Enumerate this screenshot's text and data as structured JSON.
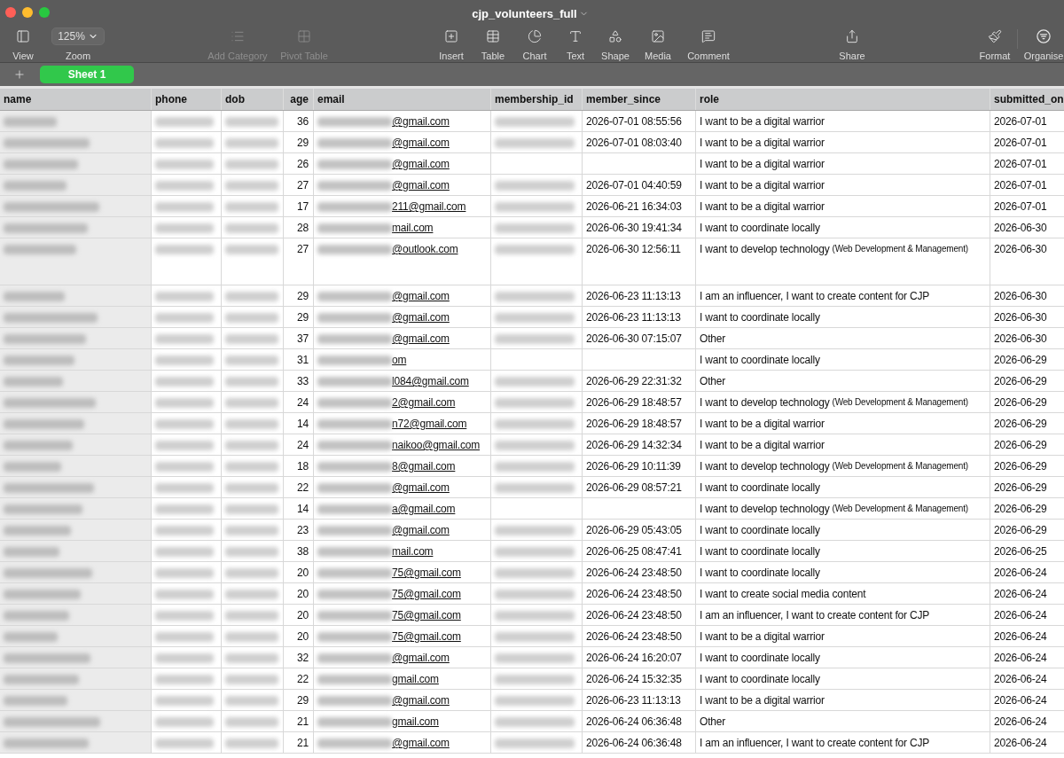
{
  "window": {
    "title": "cjp_volunteers_full"
  },
  "toolbar": [
    {
      "kind": "button",
      "label": "View",
      "disabled": false
    },
    {
      "kind": "dropdown",
      "label": "Zoom",
      "value": "125%",
      "disabled": false
    },
    {
      "kind": "button",
      "label": "Add Category",
      "disabled": true
    },
    {
      "kind": "button",
      "label": "Pivot Table",
      "disabled": true
    },
    {
      "kind": "button",
      "label": "Insert",
      "disabled": false
    },
    {
      "kind": "button",
      "label": "Table",
      "disabled": false
    },
    {
      "kind": "button",
      "label": "Chart",
      "disabled": false
    },
    {
      "kind": "button",
      "label": "Text",
      "disabled": false
    },
    {
      "kind": "button",
      "label": "Shape",
      "disabled": false
    },
    {
      "kind": "button",
      "label": "Media",
      "disabled": false
    },
    {
      "kind": "button",
      "label": "Comment",
      "disabled": false
    },
    {
      "kind": "button",
      "label": "Share",
      "disabled": false
    },
    {
      "kind": "button",
      "label": "Format",
      "disabled": false
    },
    {
      "kind": "button",
      "label": "Organise",
      "disabled": false
    }
  ],
  "sheet_tabs": [
    {
      "label": "Sheet 1",
      "selected": true
    }
  ],
  "table": {
    "columns": [
      {
        "label": "name",
        "blurred": true
      },
      {
        "label": "phone",
        "blurred": true
      },
      {
        "label": "dob",
        "blurred": true
      },
      {
        "label": "age"
      },
      {
        "label": "email",
        "blurred": true
      },
      {
        "label": "membership_id",
        "blurred": true
      },
      {
        "label": "member_since"
      },
      {
        "label": "role"
      },
      {
        "label": "submitted_on"
      }
    ],
    "rows": [
      {
        "age": "36",
        "email": "@gmail.com",
        "membership_id_blurred": true,
        "member_since": "2026-07-01 08:55:56",
        "role": "I want to be a digital warrior",
        "submitted_on": "2026-07-01"
      },
      {
        "age": "29",
        "email": "@gmail.com",
        "membership_id_blurred": true,
        "member_since": "2026-07-01 08:03:40",
        "role": "I want to be a digital warrior",
        "submitted_on": "2026-07-01"
      },
      {
        "age": "26",
        "email": "@gmail.com",
        "membership_id_blurred": false,
        "role": "I want to be a digital warrior",
        "submitted_on": "2026-07-01"
      },
      {
        "age": "27",
        "email": "@gmail.com",
        "membership_id_blurred": true,
        "member_since": "2026-07-01 04:40:59",
        "role": "I want to be a digital warrior",
        "submitted_on": "2026-07-01"
      },
      {
        "age": "17",
        "email": "211@gmail.com",
        "membership_id_blurred": true,
        "member_since": "2026-06-21 16:34:03",
        "role": "I want to be a digital warrior",
        "submitted_on": "2026-07-01"
      },
      {
        "age": "28",
        "email": "mail.com",
        "membership_id_blurred": true,
        "member_since": "2026-06-30 19:41:34",
        "role": "I want to coordinate locally",
        "submitted_on": "2026-06-30"
      },
      {
        "age": "27",
        "email": "@outlook.com",
        "membership_id_blurred": true,
        "member_since": "2026-06-30 12:56:11",
        "role": "I want to develop technology",
        "role_note": "(Web Development & Management)",
        "submitted_on": "2026-06-30",
        "tall": true
      },
      {
        "age": "29",
        "email": "@gmail.com",
        "membership_id_blurred": true,
        "member_since": "2026-06-23 11:13:13",
        "role": "I am an influencer, I want to create content for CJP",
        "submitted_on": "2026-06-30"
      },
      {
        "age": "29",
        "email": "@gmail.com",
        "membership_id_blurred": true,
        "member_since": "2026-06-23 11:13:13",
        "role": "I want to coordinate locally",
        "submitted_on": "2026-06-30"
      },
      {
        "age": "37",
        "email": "@gmail.com",
        "membership_id_blurred": true,
        "member_since": "2026-06-30 07:15:07",
        "role": "Other",
        "submitted_on": "2026-06-30"
      },
      {
        "age": "31",
        "email": "om",
        "membership_id_blurred": false,
        "role": "I want to coordinate locally",
        "submitted_on": "2026-06-29"
      },
      {
        "age": "33",
        "email": "l084@gmail.com",
        "membership_id_blurred": true,
        "member_since": "2026-06-29 22:31:32",
        "role": "Other",
        "submitted_on": "2026-06-29"
      },
      {
        "age": "24",
        "email": "2@gmail.com",
        "membership_id_blurred": true,
        "member_since": "2026-06-29 18:48:57",
        "role": "I want to develop technology",
        "role_note": "(Web Development & Management)",
        "submitted_on": "2026-06-29"
      },
      {
        "age": "14",
        "email": "n72@gmail.com",
        "membership_id_blurred": true,
        "member_since": "2026-06-29 18:48:57",
        "role": "I want to be a digital warrior",
        "submitted_on": "2026-06-29"
      },
      {
        "age": "24",
        "email": "naikoo@gmail.com",
        "membership_id_blurred": true,
        "member_since": "2026-06-29 14:32:34",
        "role": "I want to be a digital warrior",
        "submitted_on": "2026-06-29"
      },
      {
        "age": "18",
        "email": "8@gmail.com",
        "membership_id_blurred": true,
        "member_since": "2026-06-29 10:11:39",
        "role": "I want to develop technology",
        "role_note": "(Web Development & Management)",
        "submitted_on": "2026-06-29"
      },
      {
        "age": "22",
        "email": "@gmail.com",
        "membership_id_blurred": true,
        "member_since": "2026-06-29 08:57:21",
        "role": "I want to coordinate locally",
        "submitted_on": "2026-06-29"
      },
      {
        "age": "14",
        "email": "a@gmail.com",
        "membership_id_blurred": false,
        "role": "I want to develop technology",
        "role_note": "(Web Development & Management)",
        "submitted_on": "2026-06-29"
      },
      {
        "age": "23",
        "email": "@gmail.com",
        "membership_id_blurred": true,
        "member_since": "2026-06-29 05:43:05",
        "role": "I want to coordinate locally",
        "submitted_on": "2026-06-29"
      },
      {
        "age": "38",
        "email": "mail.com",
        "membership_id_blurred": true,
        "member_since": "2026-06-25 08:47:41",
        "role": "I want to coordinate locally",
        "submitted_on": "2026-06-25"
      },
      {
        "age": "20",
        "email": "75@gmail.com",
        "membership_id_blurred": true,
        "member_since": "2026-06-24 23:48:50",
        "role": "I want to coordinate locally",
        "submitted_on": "2026-06-24"
      },
      {
        "age": "20",
        "email": "75@gmail.com",
        "membership_id_blurred": true,
        "member_since": "2026-06-24 23:48:50",
        "role": "I want to create social media content",
        "submitted_on": "2026-06-24"
      },
      {
        "age": "20",
        "email": "75@gmail.com",
        "membership_id_blurred": true,
        "member_since": "2026-06-24 23:48:50",
        "role": "I am an influencer, I want to create content for CJP",
        "submitted_on": "2026-06-24"
      },
      {
        "age": "20",
        "email": "75@gmail.com",
        "membership_id_blurred": true,
        "member_since": "2026-06-24 23:48:50",
        "role": "I want to be a digital warrior",
        "submitted_on": "2026-06-24"
      },
      {
        "age": "32",
        "email": "@gmail.com",
        "membership_id_blurred": true,
        "member_since": "2026-06-24 16:20:07",
        "role": "I want to coordinate locally",
        "submitted_on": "2026-06-24"
      },
      {
        "age": "22",
        "email": "gmail.com",
        "membership_id_blurred": true,
        "member_since": "2026-06-24 15:32:35",
        "role": "I want to coordinate locally",
        "submitted_on": "2026-06-24"
      },
      {
        "age": "29",
        "email": "@gmail.com",
        "membership_id_blurred": true,
        "member_since": "2026-06-23 11:13:13",
        "role": "I want to be a digital warrior",
        "submitted_on": "2026-06-24"
      },
      {
        "age": "21",
        "email": "gmail.com",
        "membership_id_blurred": true,
        "member_since": "2026-06-24 06:36:48",
        "role": "Other",
        "submitted_on": "2026-06-24"
      },
      {
        "age": "21",
        "email": "@gmail.com",
        "membership_id_blurred": true,
        "member_since": "2026-06-24 06:36:48",
        "role": "I am an influencer, I want to create content for CJP",
        "submitted_on": "2026-06-24"
      }
    ]
  }
}
